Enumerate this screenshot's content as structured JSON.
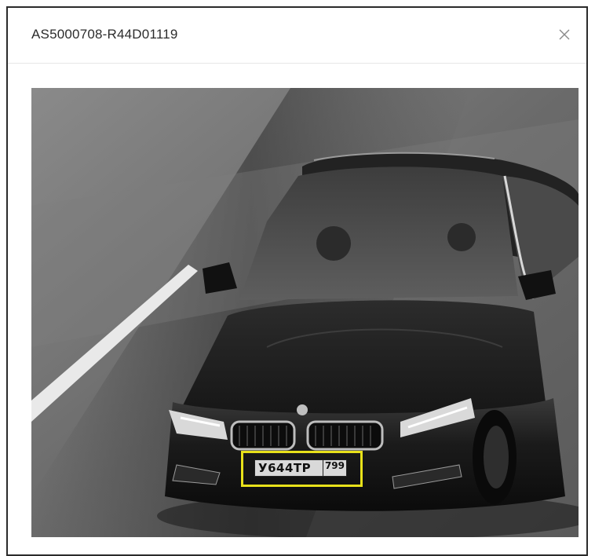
{
  "modal": {
    "title": "AS5000708-R44D01119",
    "close_icon": "close-icon",
    "image_description_icon": "vehicle-photo"
  },
  "plate": {
    "number": "У644ТР",
    "region": "799"
  },
  "colors": {
    "border": "#2b2b2b",
    "highlight": "#e8e11a",
    "divider": "#e6e6e6"
  }
}
